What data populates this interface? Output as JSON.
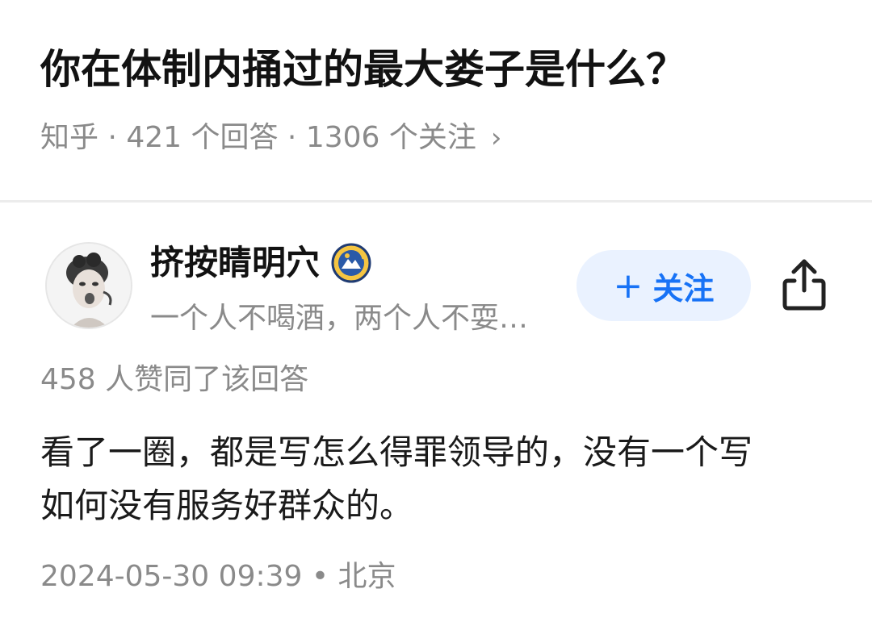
{
  "question": {
    "title": "你在体制内捅过的最大娄子是什么？",
    "meta": "知乎 · 421 个回答 · 1306 个关注",
    "chevron": "›"
  },
  "author": {
    "name": "挤按睛明穴",
    "bio": "一个人不喝酒，两个人不耍…",
    "badge_icon": "verified-badge-icon"
  },
  "follow": {
    "plus": "+",
    "label": "关注",
    "color": "#1772f6",
    "background": "#eaf2ff"
  },
  "share": {
    "icon": "share-icon"
  },
  "answer": {
    "votes": "458 人赞同了该回答",
    "line1": "看了一圈，都是写怎么得罪领导的，没有一个写",
    "line2": "如何没有服务好群众的。",
    "meta": "2024-05-30 09:39 • 北京"
  }
}
